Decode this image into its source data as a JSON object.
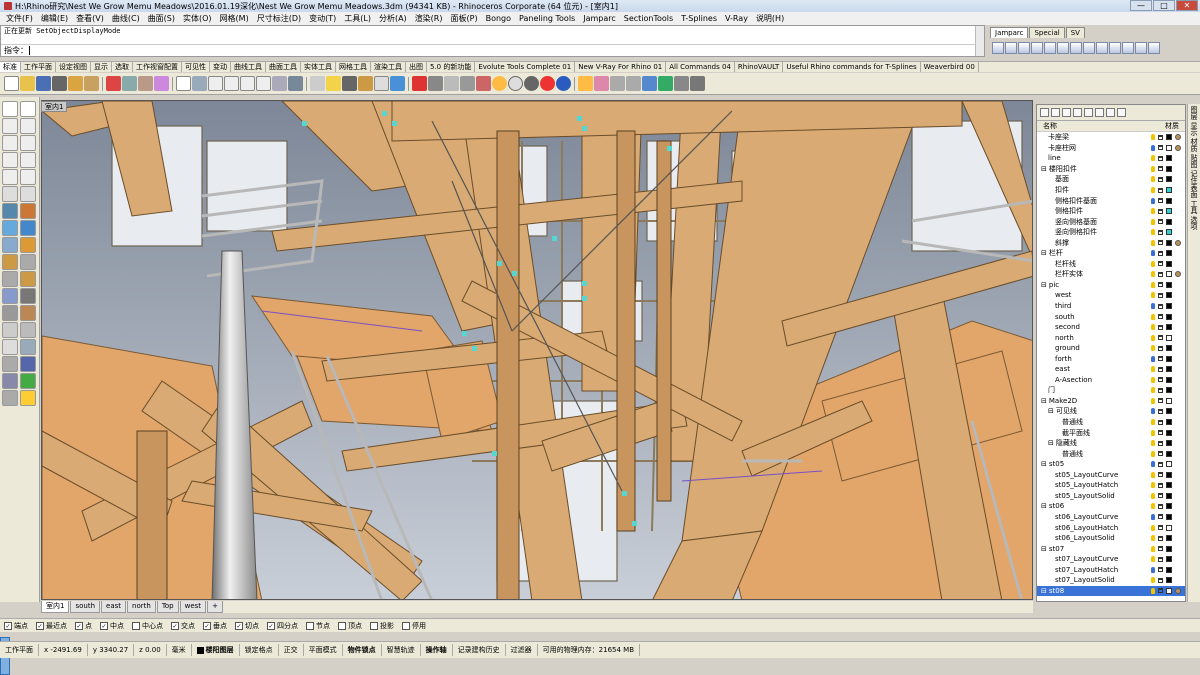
{
  "window": {
    "title": "H:\\Rhino研究\\Nest We Grow Memu Meadows\\2016.01.19深化\\Nest We Grow Memu Meadows.3dm (94341 KB) - Rhinoceros Corporate (64 位元) - [室内1]"
  },
  "menu": [
    "文件(F)",
    "编辑(E)",
    "查看(V)",
    "曲线(C)",
    "曲面(S)",
    "实体(O)",
    "网格(M)",
    "尺寸标注(D)",
    "变动(T)",
    "工具(L)",
    "分析(A)",
    "渲染(R)",
    "面板(P)",
    "Bongo",
    "Paneling Tools",
    "Jamparc",
    "SectionTools",
    "T-Splines",
    "V-Ray",
    "说明(H)"
  ],
  "command": {
    "history": "正在更新 SetObjectDisplayMode",
    "prompt": "指令："
  },
  "right_tabs": [
    "Jamparc",
    "Special",
    "SV"
  ],
  "toolbar_tabs": [
    "标准",
    "工作平面",
    "设定视图",
    "显示",
    "选取",
    "工作视窗配置",
    "可见性",
    "变动",
    "曲线工具",
    "曲面工具",
    "实体工具",
    "网格工具",
    "渲染工具",
    "出图",
    "5.0 的新功能",
    "Evolute Tools Complete 01",
    "New V-Ray For Rhino 01",
    "All Commands 04",
    "RhinoVAULT",
    "Useful Rhino commands for T-Splines",
    "Weaverbird 00"
  ],
  "viewport": {
    "name": "室内1"
  },
  "layers": {
    "header": {
      "name": "名称",
      "material": "材质"
    },
    "rows": [
      {
        "name": "卡座梁",
        "indent": 1
      },
      {
        "name": "卡座柱网",
        "indent": 1
      },
      {
        "name": "line",
        "indent": 1
      },
      {
        "name": "楼阳扣件",
        "indent": 0,
        "group": true
      },
      {
        "name": "基面",
        "indent": 2
      },
      {
        "name": "扣件",
        "indent": 2
      },
      {
        "name": "侧格扣件基面",
        "indent": 2
      },
      {
        "name": "侧格扣件",
        "indent": 2
      },
      {
        "name": "竖向侧格基面",
        "indent": 2
      },
      {
        "name": "竖向侧格扣件",
        "indent": 2
      },
      {
        "name": "斜撑",
        "indent": 2
      },
      {
        "name": "栏杆",
        "indent": 0,
        "group": true
      },
      {
        "name": "栏杆线",
        "indent": 2
      },
      {
        "name": "栏杆实体",
        "indent": 2
      },
      {
        "name": "pic",
        "indent": 0,
        "group": true
      },
      {
        "name": "west",
        "indent": 2
      },
      {
        "name": "third",
        "indent": 2
      },
      {
        "name": "south",
        "indent": 2
      },
      {
        "name": "second",
        "indent": 2
      },
      {
        "name": "north",
        "indent": 2
      },
      {
        "name": "ground",
        "indent": 2
      },
      {
        "name": "forth",
        "indent": 2
      },
      {
        "name": "east",
        "indent": 2
      },
      {
        "name": "A-Asection",
        "indent": 2
      },
      {
        "name": "门",
        "indent": 1
      },
      {
        "name": "Make2D",
        "indent": 0,
        "group": true
      },
      {
        "name": "可见线",
        "indent": 1,
        "group": true
      },
      {
        "name": "普通线",
        "indent": 3
      },
      {
        "name": "截平面线",
        "indent": 3
      },
      {
        "name": "隐藏线",
        "indent": 1,
        "group": true
      },
      {
        "name": "普通线",
        "indent": 3
      },
      {
        "name": "st05",
        "indent": 0,
        "group": true
      },
      {
        "name": "st05_LayoutCurve",
        "indent": 2
      },
      {
        "name": "st05_LayoutHatch",
        "indent": 2
      },
      {
        "name": "st05_LayoutSolid",
        "indent": 2
      },
      {
        "name": "st06",
        "indent": 0,
        "group": true
      },
      {
        "name": "st06_LayoutCurve",
        "indent": 2
      },
      {
        "name": "st06_LayoutHatch",
        "indent": 2
      },
      {
        "name": "st06_LayoutSolid",
        "indent": 2
      },
      {
        "name": "st07",
        "indent": 0,
        "group": true
      },
      {
        "name": "st07_LayoutCurve",
        "indent": 2
      },
      {
        "name": "st07_LayoutHatch",
        "indent": 2
      },
      {
        "name": "st07_LayoutSolid",
        "indent": 2
      },
      {
        "name": "st08",
        "indent": 0,
        "group": true,
        "selected": true
      }
    ]
  },
  "side_strip": [
    "图层",
    "显示",
    "材质",
    "贴图",
    "记住表面",
    "工具",
    "选项"
  ],
  "viewport_tabs": [
    "室内1",
    "south",
    "east",
    "north",
    "Top",
    "west",
    "+"
  ],
  "osnaps": [
    {
      "label": "端点",
      "on": true
    },
    {
      "label": "最近点",
      "on": true
    },
    {
      "label": "点",
      "on": true
    },
    {
      "label": "中点",
      "on": true
    },
    {
      "label": "中心点",
      "on": false
    },
    {
      "label": "交点",
      "on": true
    },
    {
      "label": "垂点",
      "on": true
    },
    {
      "label": "切点",
      "on": true
    },
    {
      "label": "四分点",
      "on": true
    },
    {
      "label": "节点",
      "on": false
    },
    {
      "label": "顶点",
      "on": false
    },
    {
      "label": "投影",
      "on": false
    },
    {
      "label": "停用",
      "on": false
    }
  ],
  "status": {
    "cplane": "工作平面",
    "x": "x -2491.69",
    "y": "y 3340.27",
    "z": "z 0.00",
    "unit": "毫米",
    "layer": "楼阳图层",
    "buttons": [
      "锁定格点",
      "正交",
      "平面模式",
      "物件锁点",
      "智慧轨迹",
      "操作轴",
      "记录建构历史",
      "过滤器"
    ],
    "memory": "可用的物理内存：21654 MB"
  },
  "colors": {
    "wood": "#d4a670",
    "accent": "#3a73d8",
    "sky": "#aeb6c2"
  }
}
